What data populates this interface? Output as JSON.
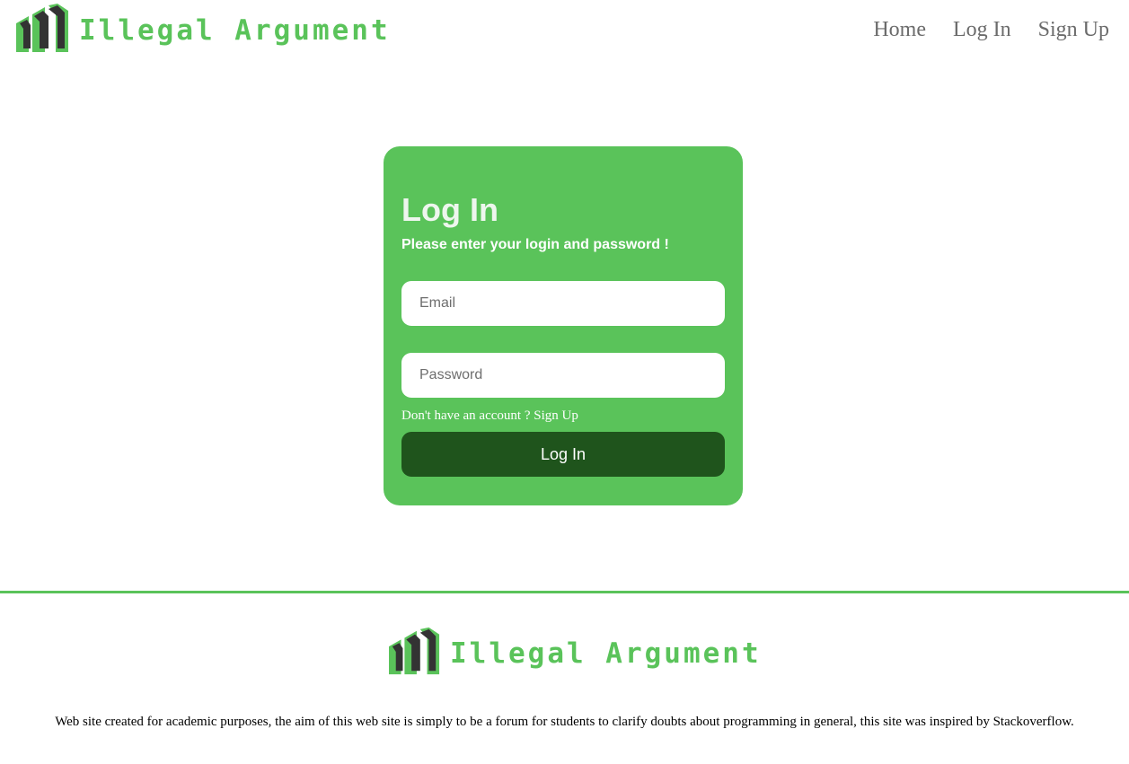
{
  "header": {
    "brand_name": "Illegal Argument",
    "nav": {
      "home": "Home",
      "login": "Log In",
      "signup": "Sign Up"
    }
  },
  "login_card": {
    "title": "Log In",
    "subtitle": "Please enter your login and password !",
    "email_placeholder": "Email",
    "password_placeholder": "Password",
    "signup_hint": "Don't have an account ? Sign Up",
    "submit_label": "Log In"
  },
  "footer": {
    "brand_name": "Illegal Argument",
    "description": "Web site created for academic purposes, the aim of this web site is simply to be a forum for students to clarify doubts about programming in general, this site was inspired by Stackoverflow."
  },
  "colors": {
    "brand_green": "#5ac35a",
    "dark_green": "#1f541c",
    "nav_gray": "#6b6b6b",
    "logo_dark": "#333333"
  },
  "icons": {
    "logo": "stacked-bars-logo-icon"
  }
}
